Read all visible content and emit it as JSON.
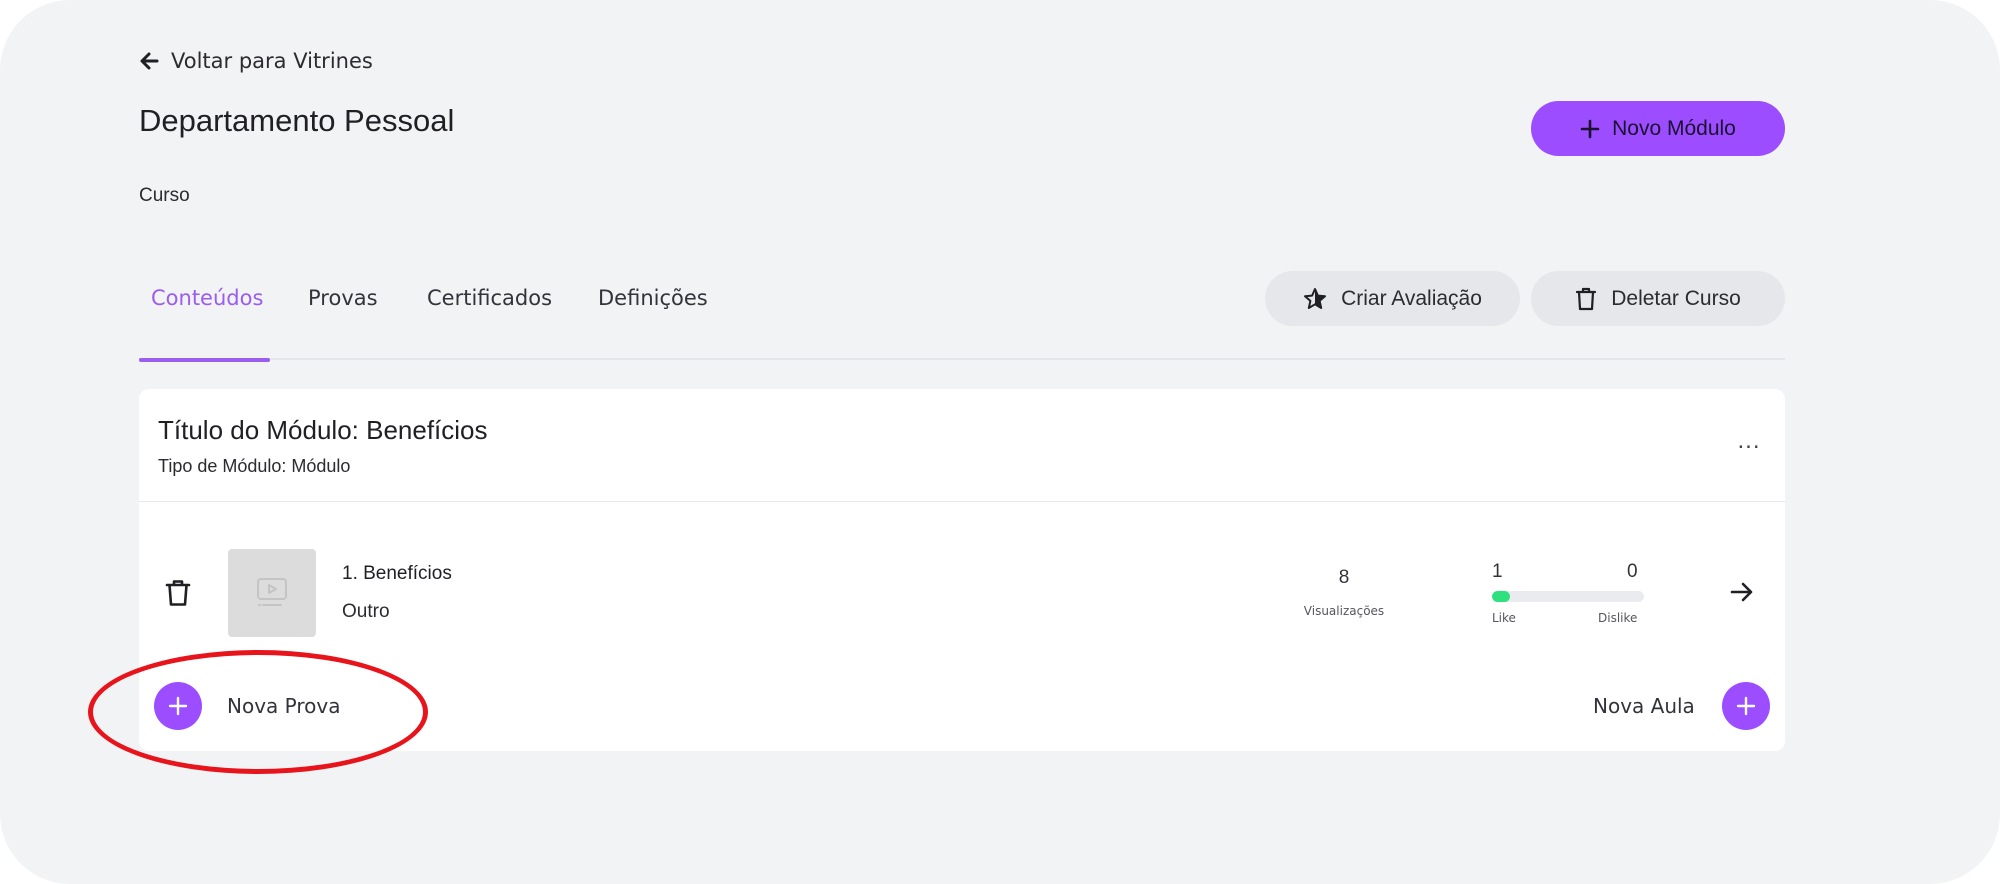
{
  "header": {
    "back_label": "Voltar para Vitrines",
    "title": "Departamento Pessoal",
    "subtitle": "Curso",
    "new_module_label": "Novo Módulo"
  },
  "tabs": [
    {
      "label": "Conteúdos",
      "active": true
    },
    {
      "label": "Provas",
      "active": false
    },
    {
      "label": "Certificados",
      "active": false
    },
    {
      "label": "Definições",
      "active": false
    }
  ],
  "actions": {
    "create_evaluation_label": "Criar Avaliação",
    "delete_course_label": "Deletar Curso"
  },
  "module": {
    "title": "Título do Módulo: Benefícios",
    "type": "Tipo de Módulo: Módulo",
    "menu_label": "...",
    "lesson": {
      "name": "1. Benefícios",
      "kind": "Outro",
      "views": "8",
      "views_label": "Visualizações",
      "likes": "1",
      "dislikes": "0",
      "like_label": "Like",
      "dislike_label": "Dislike",
      "like_ratio": 0.12
    },
    "new_exam_label": "Nova Prova",
    "new_lesson_label": "Nova Aula"
  },
  "colors": {
    "accent": "#9b4dff",
    "tab_active": "#9b5cf0",
    "like_bar": "#2fe07f",
    "annotation": "#e8141c"
  }
}
